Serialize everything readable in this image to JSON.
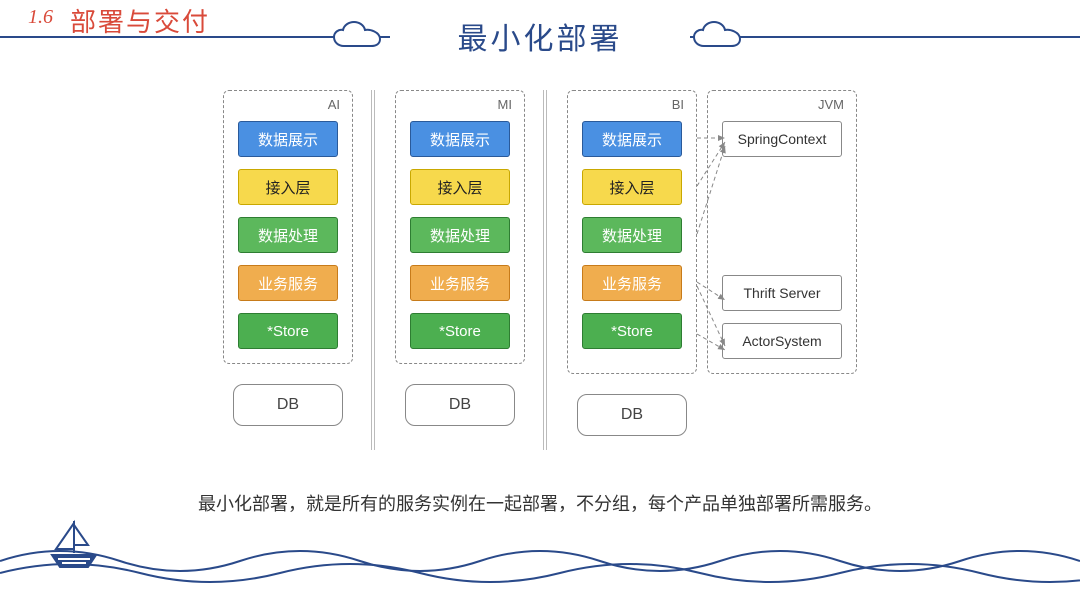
{
  "header": {
    "section_number": "1.6",
    "section_title": "部署与交付",
    "main_title": "最小化部署"
  },
  "columns": [
    {
      "label": "AI",
      "layers": [
        {
          "text": "数据展示",
          "cls": "blue"
        },
        {
          "text": "接入层",
          "cls": "yellow"
        },
        {
          "text": "数据处理",
          "cls": "green"
        },
        {
          "text": "业务服务",
          "cls": "orange"
        },
        {
          "text": "*Store",
          "cls": "green2"
        }
      ],
      "db": "DB"
    },
    {
      "label": "MI",
      "layers": [
        {
          "text": "数据展示",
          "cls": "blue"
        },
        {
          "text": "接入层",
          "cls": "yellow"
        },
        {
          "text": "数据处理",
          "cls": "green"
        },
        {
          "text": "业务服务",
          "cls": "orange"
        },
        {
          "text": "*Store",
          "cls": "green2"
        }
      ],
      "db": "DB"
    },
    {
      "label": "BI",
      "layers": [
        {
          "text": "数据展示",
          "cls": "blue"
        },
        {
          "text": "接入层",
          "cls": "yellow"
        },
        {
          "text": "数据处理",
          "cls": "green"
        },
        {
          "text": "业务服务",
          "cls": "orange"
        },
        {
          "text": "*Store",
          "cls": "green2"
        }
      ],
      "db": "DB",
      "jvm": {
        "label": "JVM",
        "items": [
          "SpringContext",
          "Thrift Server",
          "ActorSystem"
        ]
      }
    }
  ],
  "caption": "最小化部署，就是所有的服务实例在一起部署，不分组，每个产品单独部署所需服务。"
}
